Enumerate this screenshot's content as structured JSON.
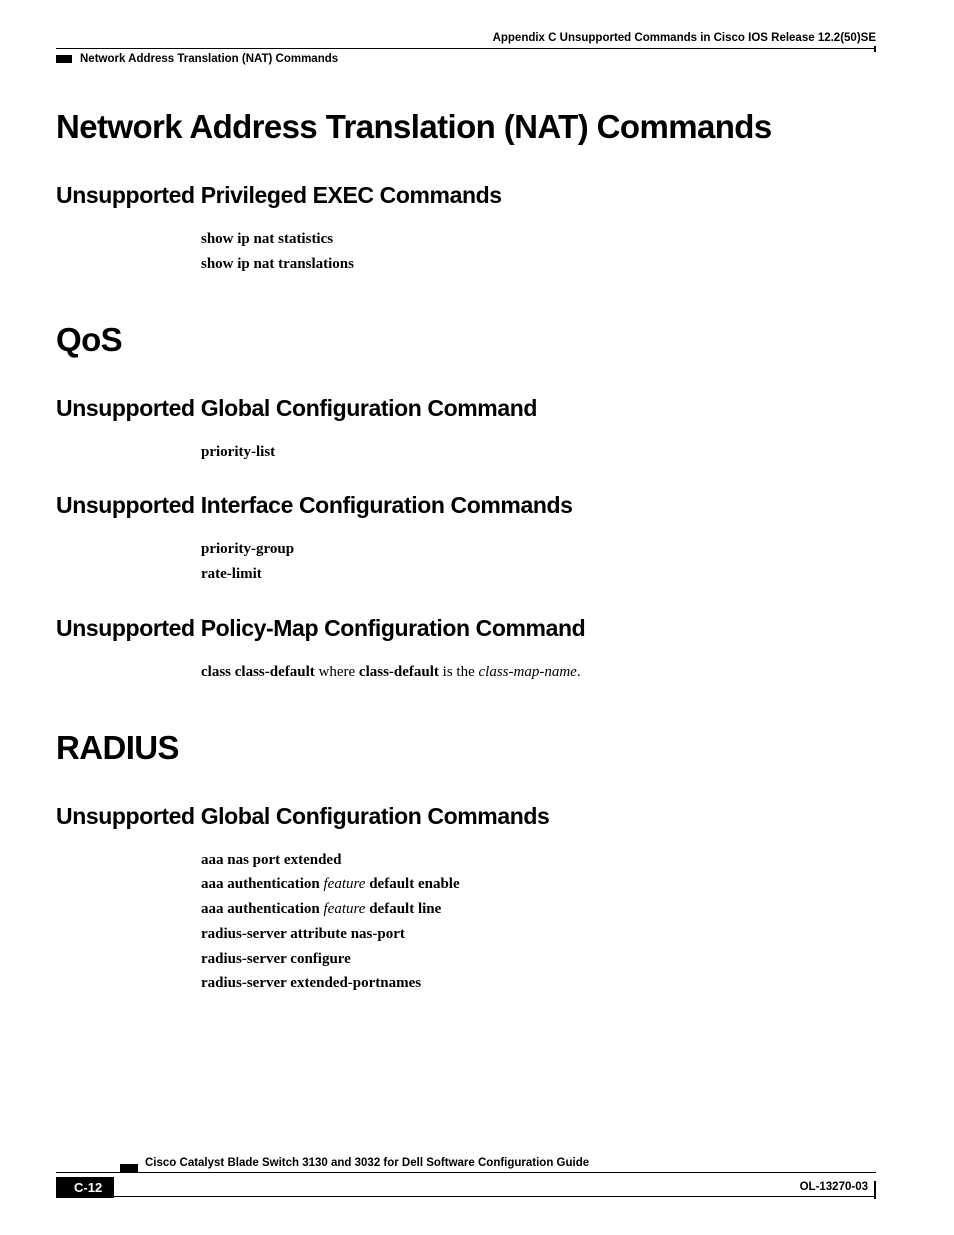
{
  "header": {
    "appendix": "Appendix C      Unsupported Commands in Cisco IOS Release 12.2(50)SE",
    "section": "Network Address Translation (NAT) Commands"
  },
  "sections": {
    "nat": {
      "title": "Network Address Translation (NAT) Commands",
      "sub1": {
        "title": "Unsupported Privileged EXEC Commands",
        "cmds": {
          "c1": "show ip nat statistics",
          "c2": "show ip nat translations"
        }
      }
    },
    "qos": {
      "title": "QoS",
      "sub1": {
        "title": "Unsupported Global Configuration Command",
        "cmds": {
          "c1": "priority-list"
        }
      },
      "sub2": {
        "title": "Unsupported Interface Configuration Commands",
        "cmds": {
          "c1": "priority-group",
          "c2": "rate-limit"
        }
      },
      "sub3": {
        "title": "Unsupported Policy-Map Configuration Command",
        "rich": {
          "p1a": "class class-default",
          "p1b": " where ",
          "p1c": "class-default",
          "p1d": " is the ",
          "p1e": "class-map-name",
          "p1f": "."
        }
      }
    },
    "radius": {
      "title": "RADIUS",
      "sub1": {
        "title": "Unsupported Global Configuration Commands",
        "cmds": {
          "c1": "aaa nas port extended",
          "c4": "radius-server attribute nas-port",
          "c5": "radius-server configure",
          "c6": "radius-server extended-portnames"
        },
        "rich": {
          "l2a": "aaa authentication ",
          "l2b": "feature",
          "l2c": " default enable",
          "l3a": "aaa authentication ",
          "l3b": "feature",
          "l3c": " default line"
        }
      }
    }
  },
  "footer": {
    "book": "Cisco Catalyst Blade Switch 3130 and 3032 for Dell Software Configuration Guide",
    "page": "C-12",
    "doc": "OL-13270-03"
  }
}
